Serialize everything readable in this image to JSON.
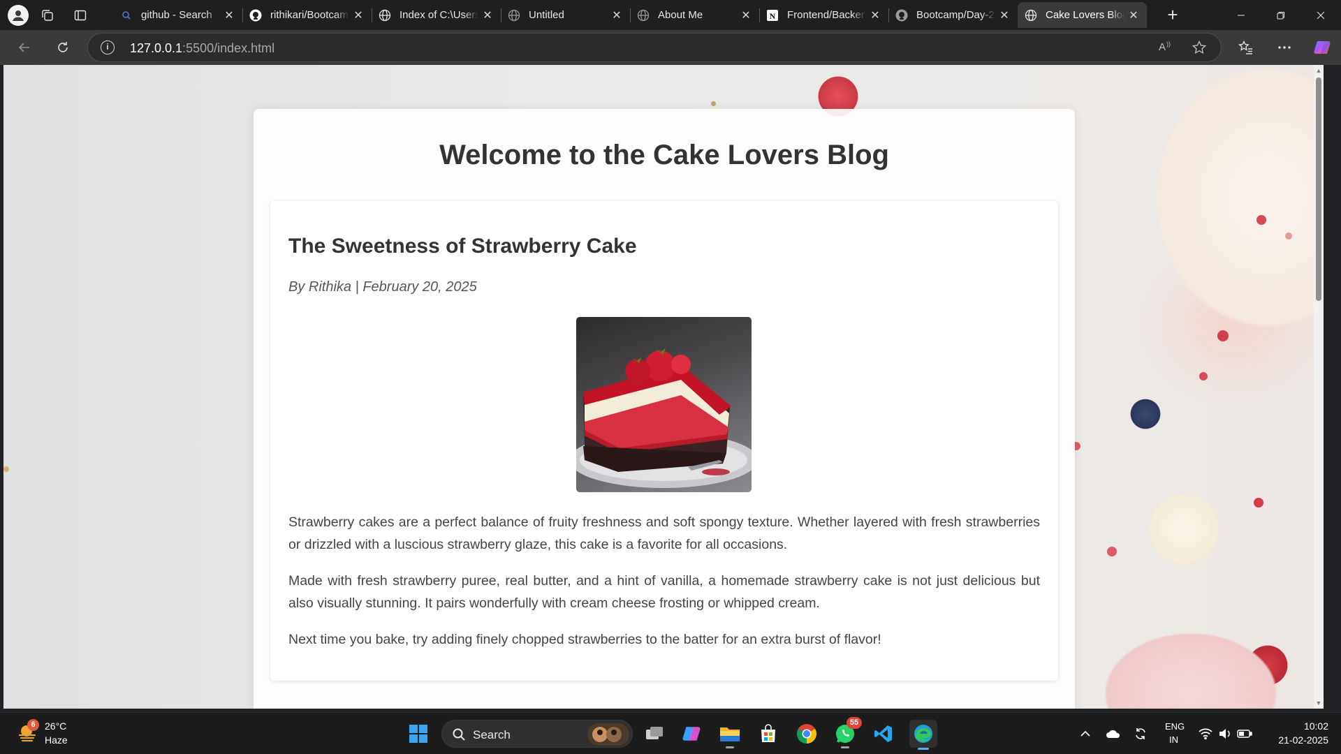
{
  "browser": {
    "tabs": [
      {
        "title": "github - Search",
        "icon": "search-icon",
        "active": false
      },
      {
        "title": "rithikari/Bootcamp",
        "icon": "github-icon",
        "active": false
      },
      {
        "title": "Index of C:\\Users\\",
        "icon": "globe-icon",
        "active": false
      },
      {
        "title": "Untitled",
        "icon": "globe-icon",
        "active": false
      },
      {
        "title": "About Me",
        "icon": "globe-icon",
        "active": false
      },
      {
        "title": "Frontend/Backend",
        "icon": "notion-icon",
        "active": false
      },
      {
        "title": "Bootcamp/Day-2",
        "icon": "github-icon",
        "active": false
      },
      {
        "title": "Cake Lovers Blog",
        "icon": "globe-icon",
        "active": true
      }
    ],
    "address": {
      "host": "127.0.0.1",
      "path": ":5500/index.html"
    }
  },
  "page": {
    "heading": "Welcome to the Cake Lovers Blog",
    "post": {
      "title": "The Sweetness of Strawberry Cake",
      "meta": "By Rithika | February 20, 2025",
      "image": "strawberry-cake-slice",
      "paragraphs": [
        "Strawberry cakes are a perfect balance of fruity freshness and soft spongy texture. Whether layered with fresh strawberries or drizzled with a luscious strawberry glaze, this cake is a favorite for all occasions.",
        "Made with fresh strawberry puree, real butter, and a hint of vanilla, a homemade strawberry cake is not just delicious but also visually stunning. It pairs wonderfully with cream cheese frosting or whipped cream.",
        "Next time you bake, try adding finely chopped strawberries to the batter for an extra burst of flavor!"
      ]
    }
  },
  "taskbar": {
    "weather": {
      "temp": "26°C",
      "condition": "Haze",
      "badge": "6"
    },
    "search_label": "Search",
    "whatsapp_badge": "55",
    "language": {
      "line1": "ENG",
      "line2": "IN"
    },
    "clock": {
      "time": "10:02",
      "date": "21-02-2025"
    }
  },
  "colors": {
    "accent": "#59a8ff",
    "title_text": "#333333",
    "body_text": "#444444"
  }
}
